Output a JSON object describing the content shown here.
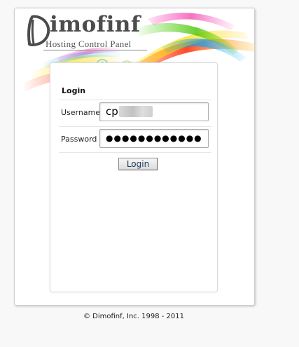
{
  "brand": {
    "name": "imofinf",
    "initial_letter": "D",
    "subtitle": "Hosting Control Panel"
  },
  "login": {
    "title": "Login",
    "username_label": "Username",
    "username_value": "cp",
    "password_label": "Password",
    "password_mask": "●●●●●●●●●●●●",
    "button_label": "Login"
  },
  "footer": {
    "copyright": "© Dimofinf, Inc. 1998 - 2011"
  },
  "colors": {
    "logo_text": "#4c4c4c",
    "button_text": "#1b3a5a",
    "panel_border": "#cfcfcf"
  }
}
